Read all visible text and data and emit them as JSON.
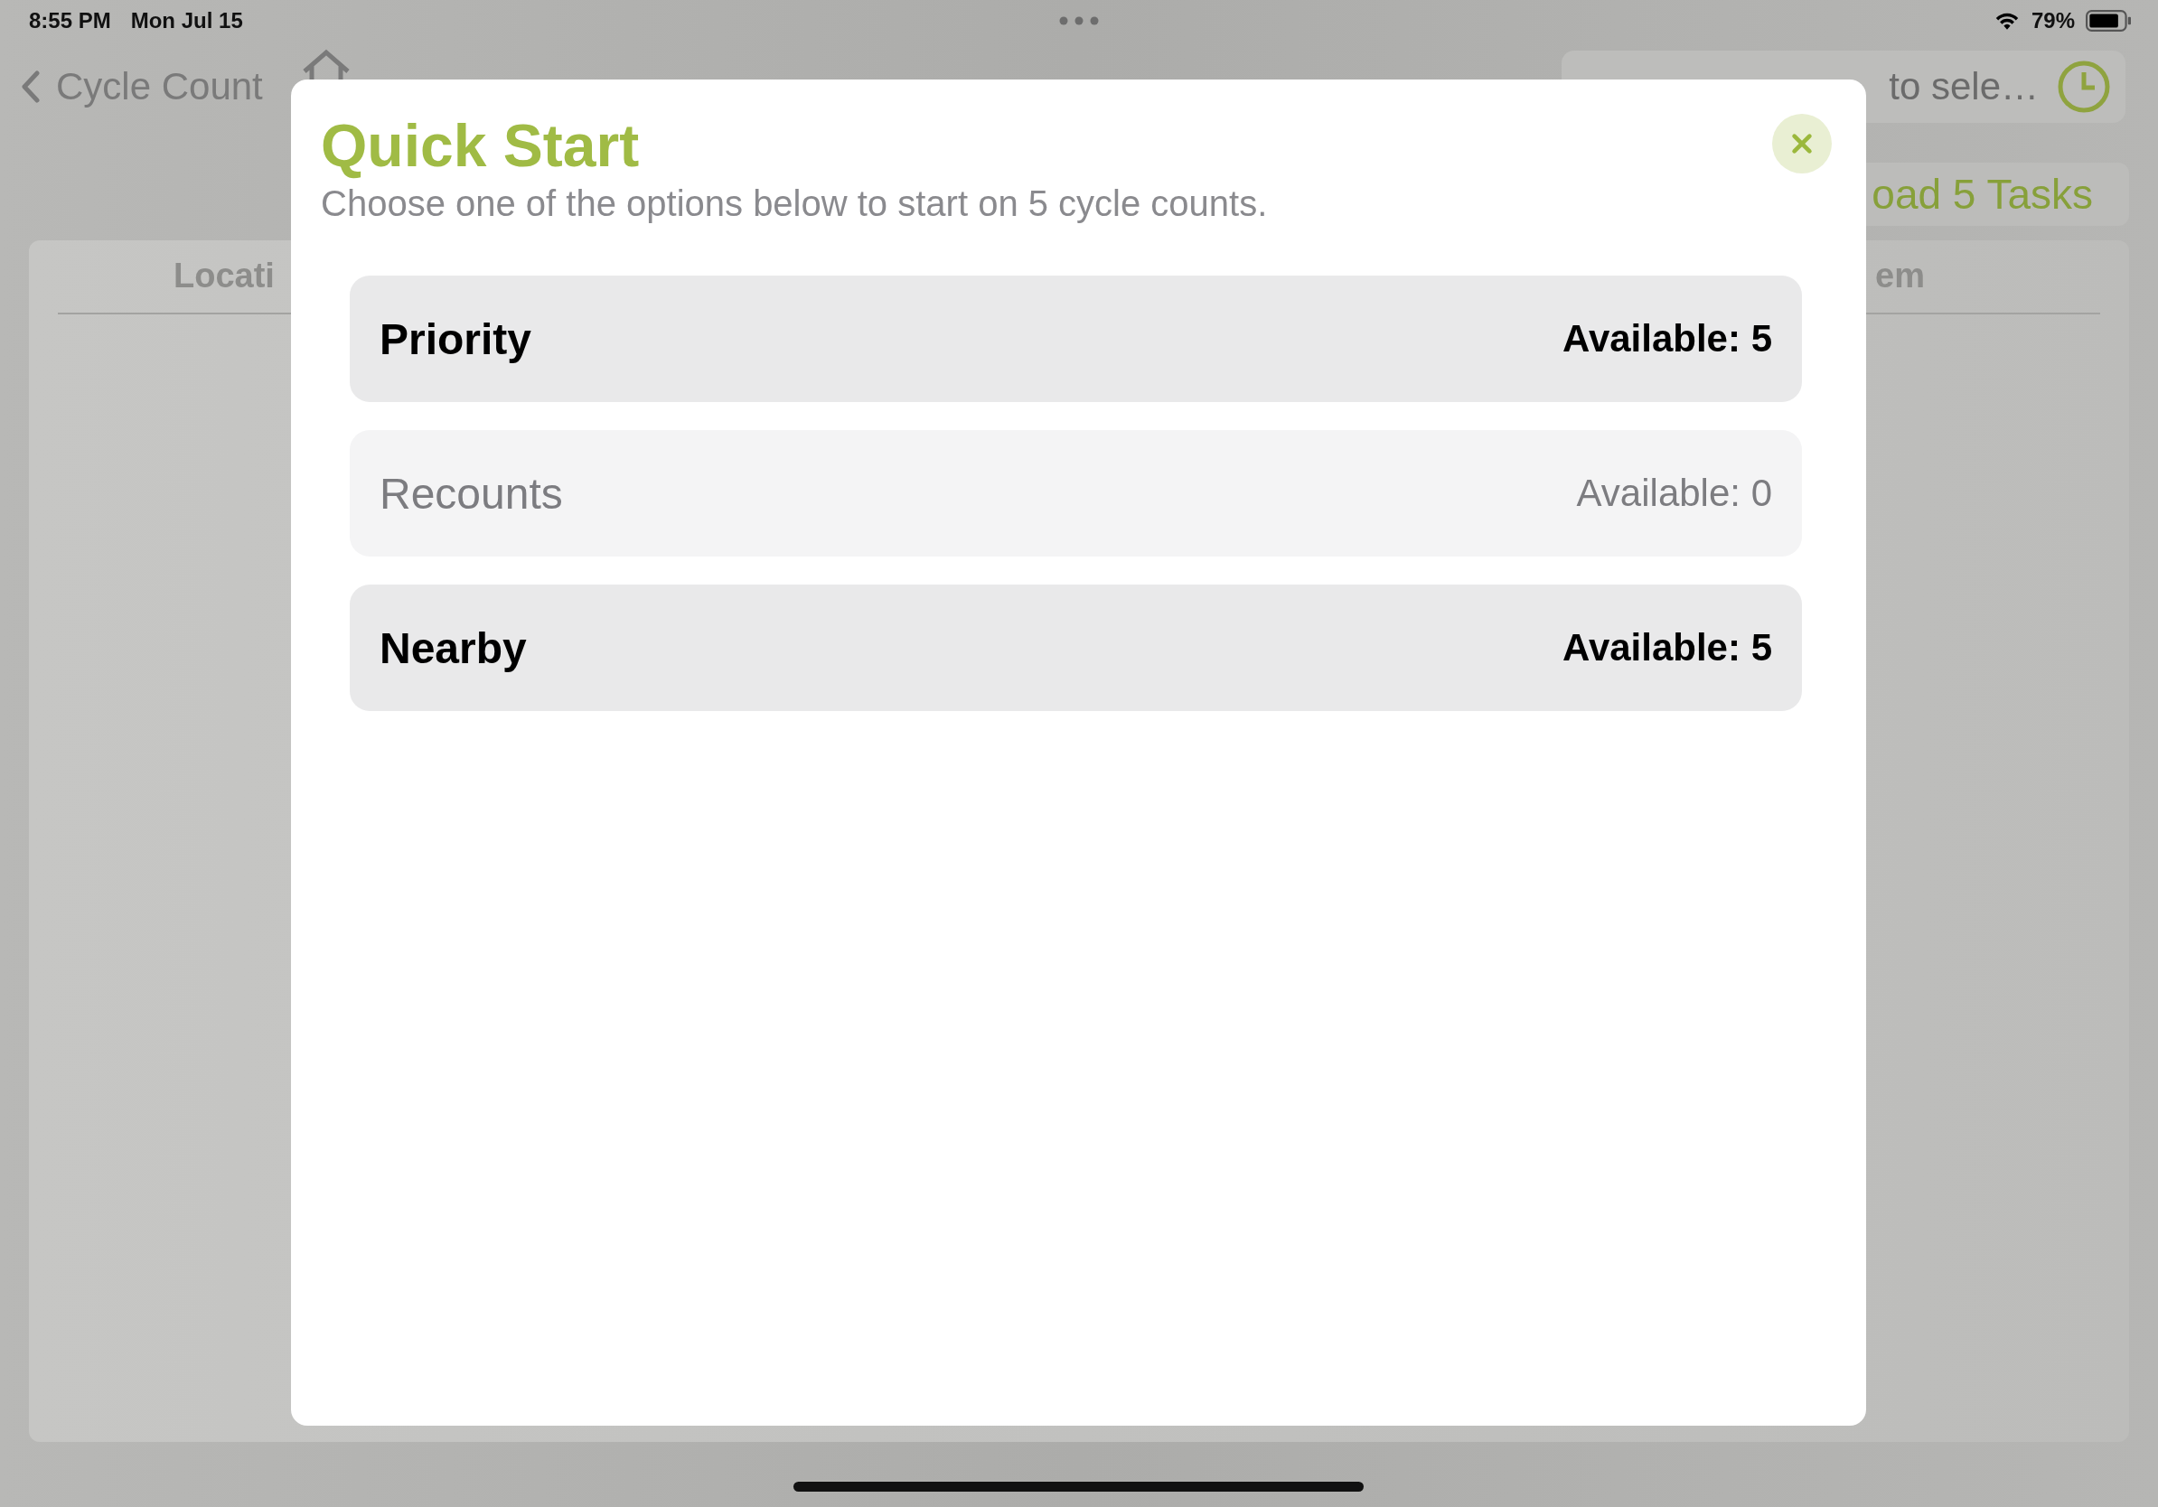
{
  "status_bar": {
    "time": "8:55 PM",
    "date": "Mon Jul 15",
    "battery": "79%"
  },
  "nav_bar": {
    "back_label": "Cycle Count",
    "search": {
      "placeholder": "to sele…"
    }
  },
  "download_button": {
    "label": "oad 5 Tasks"
  },
  "table": {
    "columns": [
      "Locati",
      "em"
    ]
  },
  "modal": {
    "title": "Quick Start",
    "subtitle": "Choose one of the options below to start on 5 cycle counts.",
    "options": [
      {
        "label": "Priority",
        "count": "Available: 5",
        "disabled": false
      },
      {
        "label": "Recounts",
        "count": "Available: 0",
        "disabled": true
      },
      {
        "label": "Nearby",
        "count": "Available: 5",
        "disabled": false
      }
    ]
  }
}
